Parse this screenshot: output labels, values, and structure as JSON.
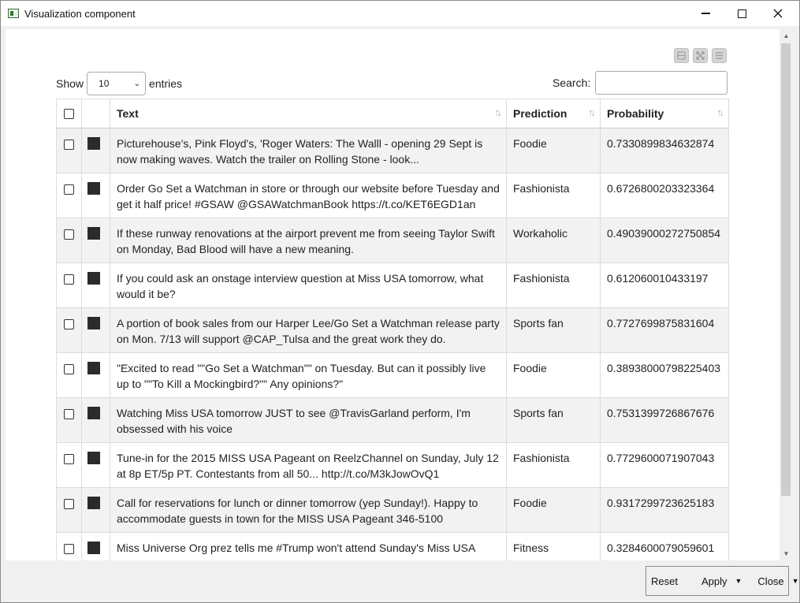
{
  "window": {
    "title": "Visualization component"
  },
  "controls": {
    "show_label": "Show",
    "entries_value": "10",
    "entries_label": "entries",
    "search_label": "Search:",
    "search_value": ""
  },
  "table": {
    "headers": {
      "text": "Text",
      "prediction": "Prediction",
      "probability": "Probability"
    },
    "rows": [
      {
        "text": "Picturehouse's, Pink Floyd's, 'Roger Waters: The Walll - opening 29 Sept is now making waves. Watch the trailer on Rolling Stone - look...",
        "prediction": "Foodie",
        "probability": "0.7330899834632874"
      },
      {
        "text": "Order Go Set a Watchman in store or through our website before Tuesday and get it half price! #GSAW @GSAWatchmanBook https://t.co/KET6EGD1an",
        "prediction": "Fashionista",
        "probability": "0.6726800203323364"
      },
      {
        "text": "If these runway renovations at the airport prevent me from seeing Taylor Swift on Monday, Bad Blood will have a new meaning.",
        "prediction": "Workaholic",
        "probability": "0.49039000272750854"
      },
      {
        "text": "If you could ask an onstage interview question at Miss USA tomorrow, what would it be?",
        "prediction": "Fashionista",
        "probability": "0.612060010433197"
      },
      {
        "text": "A portion of book sales from our Harper Lee/Go Set a Watchman release party on Mon. 7/13 will support @CAP_Tulsa and the great work they do.",
        "prediction": "Sports fan",
        "probability": "0.7727699875831604"
      },
      {
        "text": "\"Excited to read \"\"Go Set a Watchman\"\" on Tuesday. But can it possibly live up to \"\"To Kill a Mockingbird?\"\" Any opinions?\"",
        "prediction": "Foodie",
        "probability": "0.38938000798225403"
      },
      {
        "text": "Watching Miss USA tomorrow JUST to see @TravisGarland perform, I'm obsessed with his voice",
        "prediction": "Sports fan",
        "probability": "0.7531399726867676"
      },
      {
        "text": "Tune-in for the 2015 MISS USA Pageant on ReelzChannel on Sunday, July 12 at 8p ET/5p PT. Contestants from all 50... http://t.co/M3kJowOvQ1",
        "prediction": "Fashionista",
        "probability": "0.7729600071907043"
      },
      {
        "text": "Call for reservations for lunch or dinner tomorrow (yep Sunday!). Happy to accommodate guests in town for the MISS USA Pageant 346-5100",
        "prediction": "Foodie",
        "probability": "0.9317299723625183"
      },
      {
        "text": "Miss Universe Org prez tells me #Trump won't attend Sunday's Miss USA",
        "prediction": "Fitness",
        "probability": "0.3284600079059601"
      }
    ]
  },
  "footer": {
    "reset": "Reset",
    "apply": "Apply",
    "close": "Close"
  },
  "icons": {
    "minimize": "minimize-icon",
    "maximize": "maximize-icon",
    "close": "close-icon"
  }
}
